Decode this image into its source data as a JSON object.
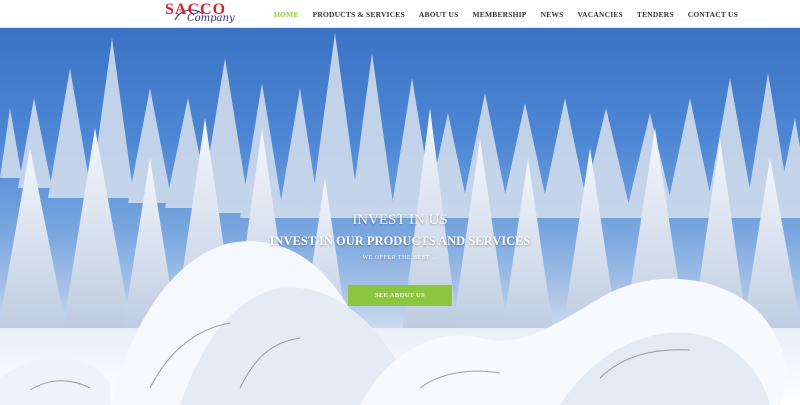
{
  "logo": {
    "main": "SACCO",
    "sub": "Company"
  },
  "nav": {
    "items": [
      {
        "label": "HOME",
        "active": true
      },
      {
        "label": "PRODUCTS & SERVICES",
        "active": false
      },
      {
        "label": "ABOUT US",
        "active": false
      },
      {
        "label": "MEMBERSHIP",
        "active": false
      },
      {
        "label": "NEWS",
        "active": false
      },
      {
        "label": "VACANCIES",
        "active": false
      },
      {
        "label": "TENDERS",
        "active": false
      },
      {
        "label": "CONTACT US",
        "active": false
      }
    ]
  },
  "hero": {
    "title": "INVEST IN US",
    "subtitle": "INVEST IN OUR PRODUCTS AND SERVICES",
    "tagline": "WE OFFER THE BEST ...",
    "cta_label": "SEE ABOUT US"
  },
  "colors": {
    "accent": "#8cc63f",
    "logo_red": "#d8202a",
    "logo_blue": "#2b2f7a",
    "nav_text": "#333333"
  }
}
